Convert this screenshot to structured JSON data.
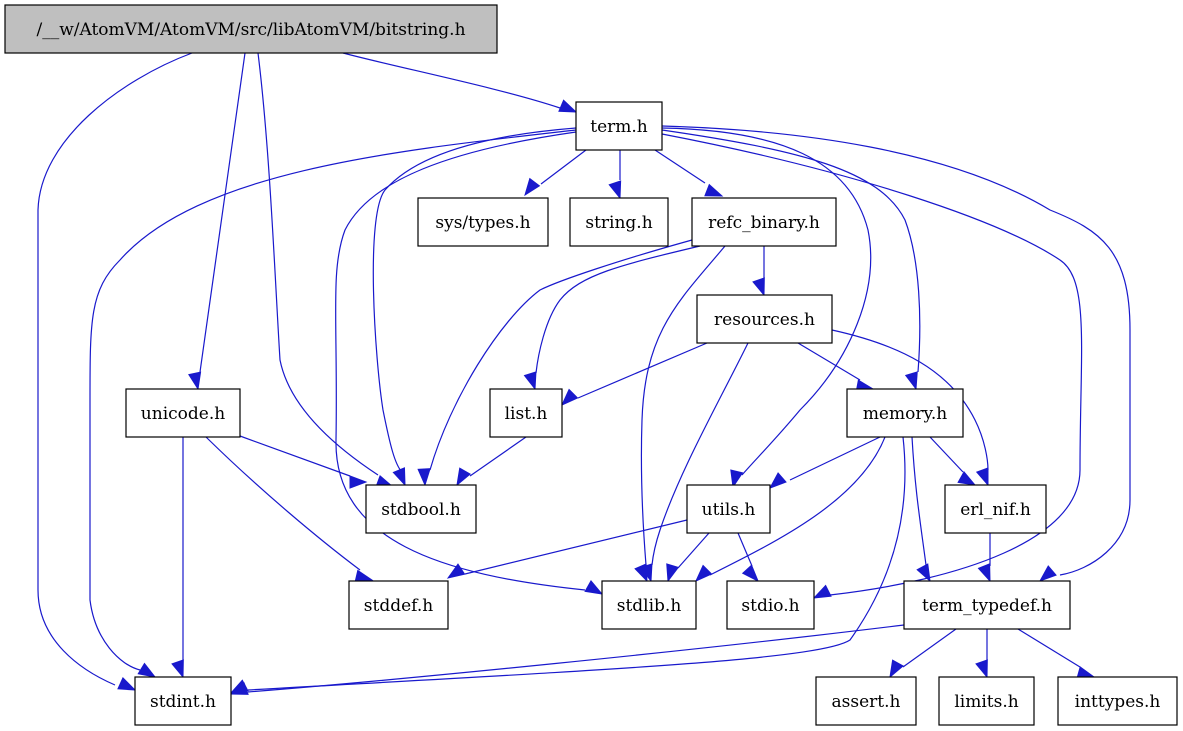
{
  "graph": {
    "title": "/__w/AtomVM/AtomVM/src/libAtomVM/bitstring.h",
    "colors": {
      "root_fill": "#bfbfbf",
      "node_fill": "#ffffff",
      "edge": "#1919cc",
      "border": "#000000"
    },
    "nodes": [
      {
        "id": "bitstring",
        "label": "/__w/AtomVM/AtomVM/src/libAtomVM/bitstring.h",
        "root": true
      },
      {
        "id": "term",
        "label": "term.h"
      },
      {
        "id": "systypes",
        "label": "sys/types.h"
      },
      {
        "id": "string",
        "label": "string.h"
      },
      {
        "id": "refc_binary",
        "label": "refc_binary.h"
      },
      {
        "id": "resources",
        "label": "resources.h"
      },
      {
        "id": "unicode",
        "label": "unicode.h"
      },
      {
        "id": "list",
        "label": "list.h"
      },
      {
        "id": "memory",
        "label": "memory.h"
      },
      {
        "id": "stdbool",
        "label": "stdbool.h"
      },
      {
        "id": "utils",
        "label": "utils.h"
      },
      {
        "id": "erl_nif",
        "label": "erl_nif.h"
      },
      {
        "id": "stddef",
        "label": "stddef.h"
      },
      {
        "id": "stdlib",
        "label": "stdlib.h"
      },
      {
        "id": "stdio",
        "label": "stdio.h"
      },
      {
        "id": "term_typedef",
        "label": "term_typedef.h"
      },
      {
        "id": "stdint",
        "label": "stdint.h"
      },
      {
        "id": "assert",
        "label": "assert.h"
      },
      {
        "id": "limits",
        "label": "limits.h"
      },
      {
        "id": "inttypes",
        "label": "inttypes.h"
      }
    ],
    "edges": [
      [
        "bitstring",
        "term"
      ],
      [
        "bitstring",
        "stdint"
      ],
      [
        "bitstring",
        "unicode"
      ],
      [
        "bitstring",
        "stdbool"
      ],
      [
        "term",
        "systypes"
      ],
      [
        "term",
        "string"
      ],
      [
        "term",
        "refc_binary"
      ],
      [
        "term",
        "stdint"
      ],
      [
        "term",
        "stdbool"
      ],
      [
        "term",
        "stdlib"
      ],
      [
        "term",
        "utils"
      ],
      [
        "term",
        "memory"
      ],
      [
        "term",
        "stdio"
      ],
      [
        "term",
        "term_typedef"
      ],
      [
        "refc_binary",
        "resources"
      ],
      [
        "refc_binary",
        "list"
      ],
      [
        "refc_binary",
        "stdbool"
      ],
      [
        "refc_binary",
        "stdlib"
      ],
      [
        "resources",
        "list"
      ],
      [
        "resources",
        "memory"
      ],
      [
        "resources",
        "erl_nif"
      ],
      [
        "resources",
        "stdlib"
      ],
      [
        "unicode",
        "stdbool"
      ],
      [
        "unicode",
        "stddef"
      ],
      [
        "unicode",
        "stdint"
      ],
      [
        "list",
        "stdbool"
      ],
      [
        "memory",
        "utils"
      ],
      [
        "memory",
        "erl_nif"
      ],
      [
        "memory",
        "stdlib"
      ],
      [
        "memory",
        "term_typedef"
      ],
      [
        "memory",
        "stdint"
      ],
      [
        "utils",
        "stddef"
      ],
      [
        "utils",
        "stdlib"
      ],
      [
        "utils",
        "stdio"
      ],
      [
        "erl_nif",
        "term_typedef"
      ],
      [
        "term_typedef",
        "stdint"
      ],
      [
        "term_typedef",
        "assert"
      ],
      [
        "term_typedef",
        "limits"
      ],
      [
        "term_typedef",
        "inttypes"
      ]
    ]
  }
}
